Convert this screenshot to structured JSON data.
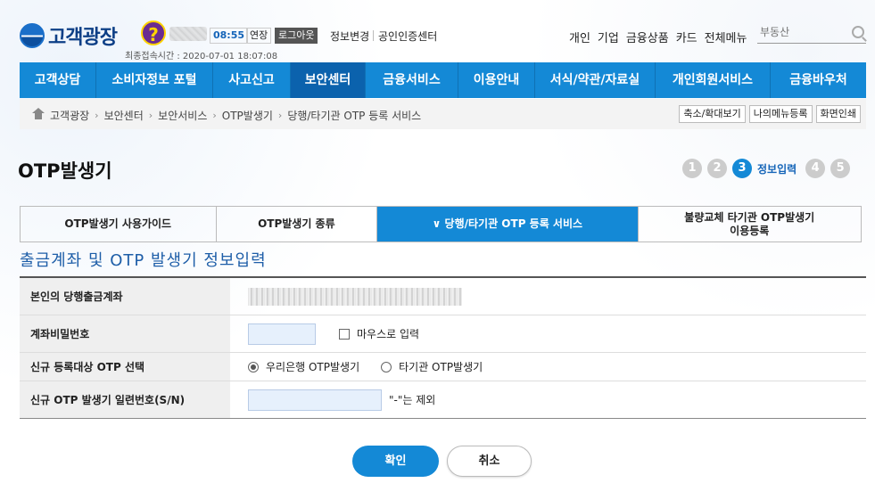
{
  "header": {
    "logo_text": "고객광장",
    "help_icon": "question-mark-icon",
    "timer": "08:55",
    "extend_label": "연장",
    "logout_label": "로그아웃",
    "link_info_change": "정보변경",
    "link_cert_center": "공인인증센터",
    "last_login": "최종접속시간 :  2020-07-01 18:07:08",
    "top_menu": [
      "개인",
      "기업",
      "금융상품",
      "카드",
      "전체메뉴"
    ],
    "search_placeholder": "부동산"
  },
  "nav": {
    "items": [
      {
        "label": "고객상담"
      },
      {
        "label": "소비자정보 포털"
      },
      {
        "label": "사고신고"
      },
      {
        "label": "보안센터"
      },
      {
        "label": "금융서비스"
      },
      {
        "label": "이용안내"
      },
      {
        "label": "서식/약관/자료실"
      },
      {
        "label": "개인회원서비스"
      },
      {
        "label": "금융바우처"
      }
    ],
    "active_index": 3
  },
  "breadcrumb": {
    "items": [
      "고객광장",
      "보안센터",
      "보안서비스",
      "OTP발생기",
      "당행/타기관 OTP 등록 서비스"
    ],
    "buttons": [
      "축소/확대보기",
      "나의메뉴등록",
      "화면인쇄"
    ]
  },
  "page": {
    "title": "OTP발생기",
    "steps": [
      "1",
      "2",
      "3",
      "4",
      "5"
    ],
    "active_step_label": "정보입력"
  },
  "tabs": [
    {
      "label": "OTP발생기 사용가이드"
    },
    {
      "label": "OTP발생기 종류"
    },
    {
      "label": "∨ 당행/타기관 OTP 등록 서비스"
    },
    {
      "label_line1": "불량교체 타기관 OTP발생기",
      "label_line2": "이용등록"
    }
  ],
  "form": {
    "section_title": "출금계좌 및 OTP 발생기 정보입력",
    "rows": {
      "account_label": "본인의 당행출금계좌",
      "password_label": "계좌비밀번호",
      "mouse_input_label": "마우스로 입력",
      "otp_select_label": "신규 등록대상 OTP 선택",
      "otp_option_woori": "우리은행 OTP발생기",
      "otp_option_other": "타기관 OTP발생기",
      "serial_label": "신규 OTP 발생기 일련번호(S/N)",
      "serial_note": "\"-\"는 제외"
    }
  },
  "actions": {
    "confirm": "확인",
    "cancel": "취소"
  },
  "colors": {
    "accent": "#1489d6",
    "nav_active": "#0b62ad",
    "title_blue": "#1e5ea8"
  }
}
